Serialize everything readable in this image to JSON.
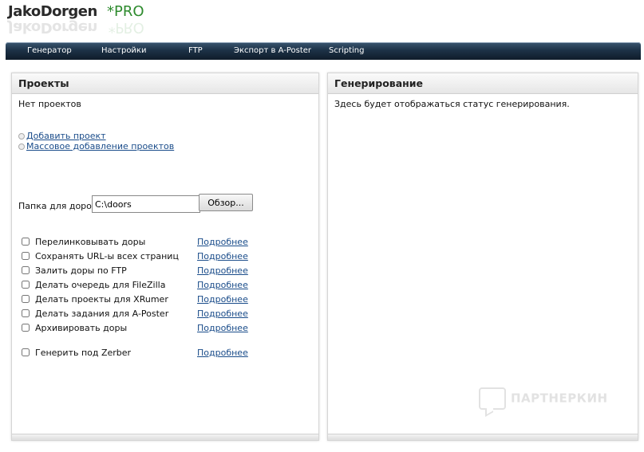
{
  "logo": {
    "main": "JakoDorgen",
    "pro": "*PRO"
  },
  "nav": {
    "items": [
      {
        "label": "Генератор"
      },
      {
        "label": "Настройки"
      },
      {
        "label": "FTP"
      },
      {
        "label": "Экспорт в A-Poster"
      },
      {
        "label": "Scripting"
      }
    ]
  },
  "projects_panel": {
    "title": "Проекты",
    "empty_text": "Нет проектов",
    "add_project_link": "Добавить проект",
    "bulk_add_link": "Массовое добавление проектов",
    "folder_label": "Папка для доров:",
    "folder_value": "C:\\doors",
    "browse_button": "Обзор...",
    "more_label": "Подробнее",
    "options": [
      {
        "label": "Перелинковывать доры",
        "checked": false
      },
      {
        "label": "Сохранять URL-ы всех страниц",
        "checked": false
      },
      {
        "label": "Залить доры по FTP",
        "checked": false
      },
      {
        "label": "Делать очередь для FileZilla",
        "checked": false
      },
      {
        "label": "Делать проекты для XRumer",
        "checked": false
      },
      {
        "label": "Делать задания для A-Poster",
        "checked": false
      },
      {
        "label": "Архивировать доры",
        "checked": false
      },
      {
        "label": "Генерить под Zerber",
        "checked": false
      }
    ]
  },
  "generation_panel": {
    "title": "Генерирование",
    "status_text": "Здесь будет отображаться статус генерирования."
  },
  "watermark": {
    "text": "ПАРТНЕРКИН"
  }
}
